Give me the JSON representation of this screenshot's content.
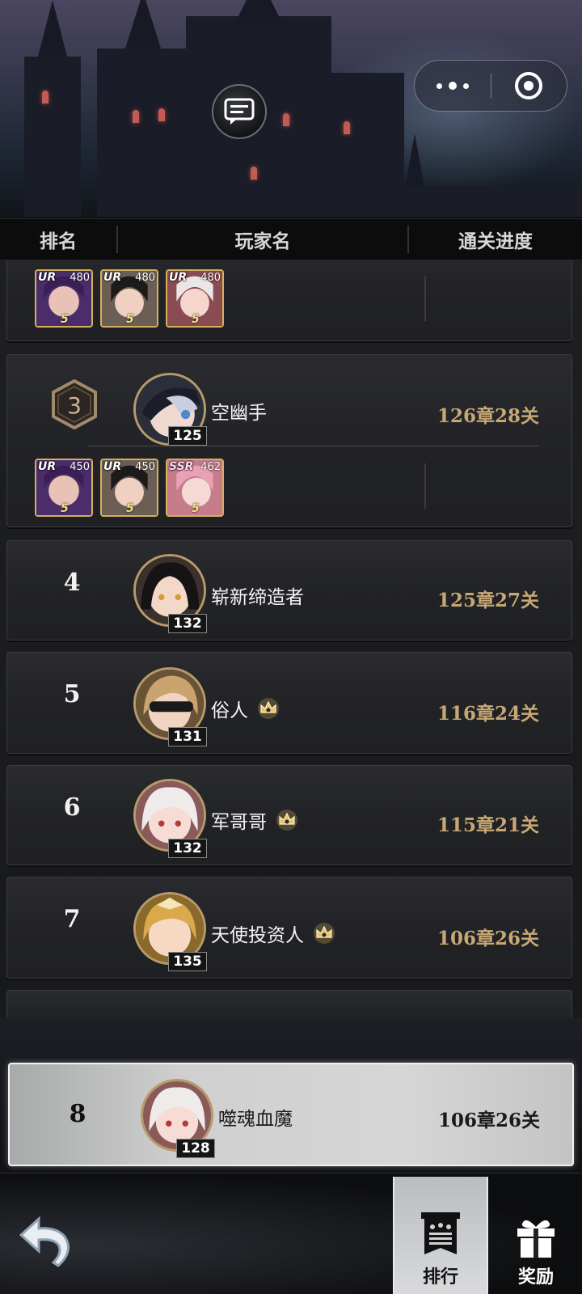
{
  "table_header": {
    "rank": "排名",
    "player": "玩家名",
    "progress": "通关进度"
  },
  "rows": [
    {
      "rank": "",
      "name": "",
      "level": "",
      "progress": "",
      "heroes": [
        {
          "tag": "UR",
          "level": "480",
          "star": "5"
        },
        {
          "tag": "UR",
          "level": "480",
          "star": "5"
        },
        {
          "tag": "UR",
          "level": "480",
          "star": "5"
        }
      ]
    },
    {
      "rank": "3",
      "name": "空幽手",
      "level": "125",
      "progress": "126章28关",
      "heroes": [
        {
          "tag": "UR",
          "level": "450",
          "star": "5"
        },
        {
          "tag": "UR",
          "level": "450",
          "star": "5"
        },
        {
          "tag": "SSR",
          "level": "462",
          "star": "5"
        }
      ]
    },
    {
      "rank": "4",
      "name": "崭新缔造者",
      "level": "132",
      "progress": "125章27关"
    },
    {
      "rank": "5",
      "name": "俗人",
      "level": "131",
      "progress": "116章24关"
    },
    {
      "rank": "6",
      "name": "军哥哥",
      "level": "132",
      "progress": "115章21关"
    },
    {
      "rank": "7",
      "name": "天使投资人",
      "level": "135",
      "progress": "106章26关"
    }
  ],
  "my_rank": {
    "rank": "8",
    "name": "噬魂血魔",
    "level": "128",
    "progress": "106章26关"
  },
  "tabs": {
    "rank_label": "排行",
    "reward_label": "奖励"
  },
  "icons": {
    "chat": "chat-bubble-icon",
    "more": "more-dots-icon",
    "close": "target-close-icon",
    "vip": "vip-crown-icon",
    "back": "back-arrow-icon",
    "rank": "rank-banner-icon",
    "reward": "gift-box-icon"
  },
  "colors": {
    "progress_gold": "#c7a874",
    "frame_gold": "#b79a6a",
    "card_bg": "#222326",
    "active_tab": "#d0d2d4"
  }
}
